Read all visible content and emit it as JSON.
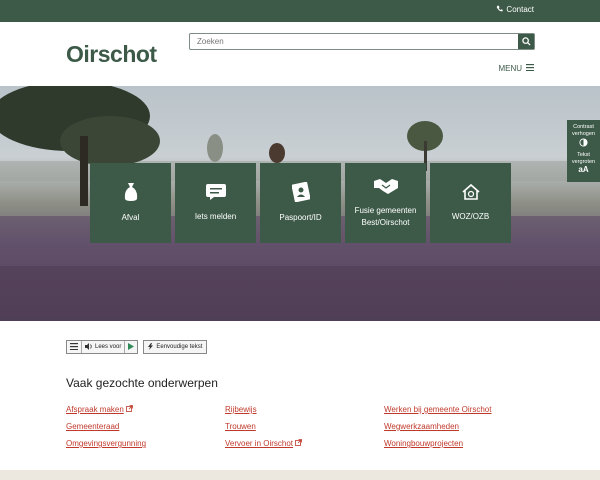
{
  "topbar": {
    "contact_label": "Contact"
  },
  "header": {
    "logo": "Oirschot",
    "search_placeholder": "Zoeken",
    "menu_label": "MENU"
  },
  "tiles": [
    {
      "label": "Afval",
      "icon": "bag-icon"
    },
    {
      "label": "Iets melden",
      "icon": "chat-icon"
    },
    {
      "label": "Paspoort/ID",
      "icon": "id-card-icon"
    },
    {
      "label": "Fusie gemeenten Best/Oirschot",
      "icon": "handshake-icon"
    },
    {
      "label": "WOZ/OZB",
      "icon": "house-euro-icon"
    }
  ],
  "side_tools": {
    "contrast_label": "Contrast verhogen",
    "textsize_label": "Tekst vergroten",
    "textsize_glyph": "aA"
  },
  "readspeaker": {
    "read_label": "Lees voor",
    "simple_text_label": "Eenvoudige tekst"
  },
  "popular": {
    "title": "Vaak gezochte onderwerpen",
    "links": [
      {
        "label": "Afspraak maken",
        "external": true
      },
      {
        "label": "Gemeenteraad",
        "external": false
      },
      {
        "label": "Omgevingsvergunning",
        "external": false
      },
      {
        "label": "Rijbewijs",
        "external": false
      },
      {
        "label": "Trouwen",
        "external": false
      },
      {
        "label": "Vervoer in Oirschot",
        "external": true
      },
      {
        "label": "Werken bij gemeente Oirschot",
        "external": false
      },
      {
        "label": "Wegwerkzaamheden",
        "external": false
      },
      {
        "label": "Woningbouwprojecten",
        "external": false
      }
    ]
  },
  "colors": {
    "brand": "#3d5a48",
    "link": "#c0392b"
  }
}
